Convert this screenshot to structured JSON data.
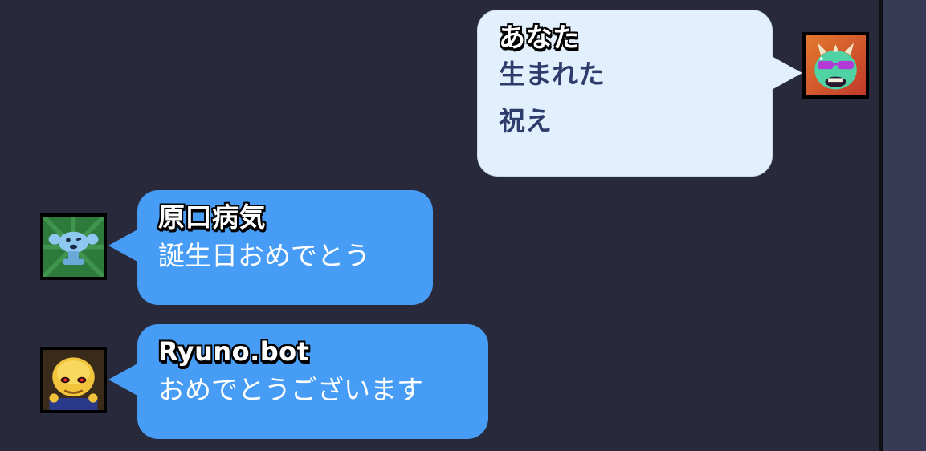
{
  "messages": [
    {
      "sender": "あなた",
      "lines": [
        "生まれた",
        "祝え"
      ],
      "avatar_icon": "masked-horned-creature-icon",
      "side": "right"
    },
    {
      "sender": "原口病気",
      "lines": [
        "誕生日おめでとう"
      ],
      "avatar_icon": "winking-trophy-icon",
      "side": "left"
    },
    {
      "sender": "Ryuno.bot",
      "lines": [
        "おめでとうございます"
      ],
      "avatar_icon": "golden-skull-brawler-icon",
      "side": "left"
    }
  ],
  "colors": {
    "background": "#282a3b",
    "own_bubble": "#e1f0fc",
    "other_bubble": "#479df6",
    "own_text": "#2e3c6c",
    "side_panel": "#363a52"
  }
}
